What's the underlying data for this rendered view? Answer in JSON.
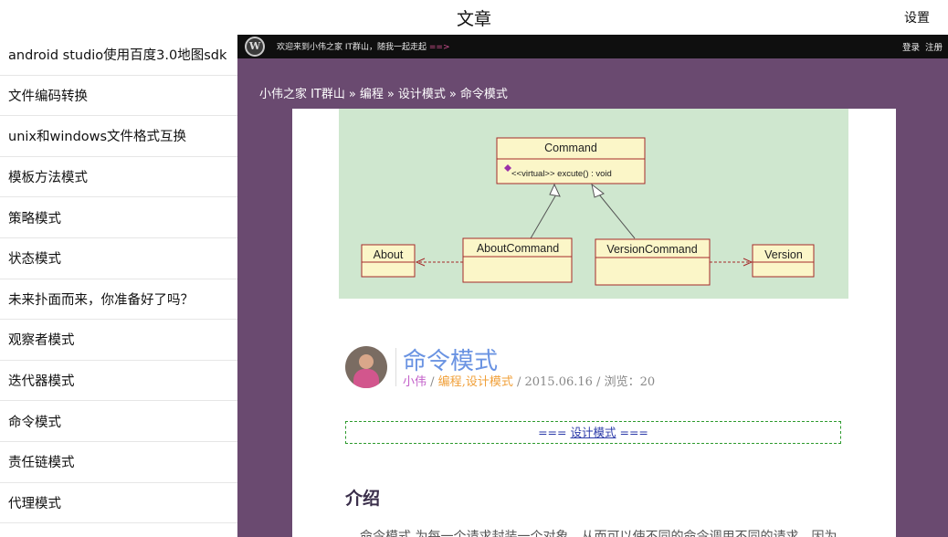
{
  "app": {
    "title": "文章",
    "settings_label": "设置"
  },
  "sidebar": {
    "items": [
      {
        "label": "android studio使用百度3.0地图sdk"
      },
      {
        "label": "文件编码转换"
      },
      {
        "label": "unix和windows文件格式互换"
      },
      {
        "label": "模板方法模式"
      },
      {
        "label": "策略模式"
      },
      {
        "label": "状态模式"
      },
      {
        "label": "未来扑面而来，你准备好了吗？"
      },
      {
        "label": "观察者模式"
      },
      {
        "label": "迭代器模式"
      },
      {
        "label": "命令模式"
      },
      {
        "label": "责任链模式"
      },
      {
        "label": "代理模式"
      }
    ]
  },
  "site": {
    "logo_letter": "W",
    "welcome": "欢迎来到小伟之家 IT群山，随我一起走起",
    "welcome_arrow": " ==>",
    "login": "登录",
    "register": "注册"
  },
  "breadcrumb": {
    "home": "小伟之家 IT群山",
    "sep": "»",
    "cat1": "编程",
    "cat2": "设计模式",
    "current": "命令模式"
  },
  "diagram": {
    "command_class": "Command",
    "command_method": "<<virtual>> excute() : void",
    "about": "About",
    "about_command": "AboutCommand",
    "version_command": "VersionCommand",
    "version": "Version"
  },
  "post": {
    "title": "命令模式",
    "author": "小伟",
    "sep1": " / ",
    "category1": "编程",
    "comma": ",",
    "category2": "设计模式",
    "date_views": " / 2015.06.16 / 浏览：20"
  },
  "series": {
    "prefix": "=== ",
    "link": "设计模式",
    "suffix": " ==="
  },
  "section": {
    "heading": "介绍",
    "text_partial": "命令模式 为每一个请求封装一个对象，从而可以使不同的命令调用不同的请求，因为"
  },
  "colors": {
    "page_bg": "#6a4a70",
    "title_blue": "#6a93e2",
    "author_purple": "#c25fc9",
    "category_orange": "#f0a03a",
    "uml_bg": "#cfe7cf",
    "uml_class_fill": "#fbf6c8",
    "uml_border": "#a52a2a"
  }
}
